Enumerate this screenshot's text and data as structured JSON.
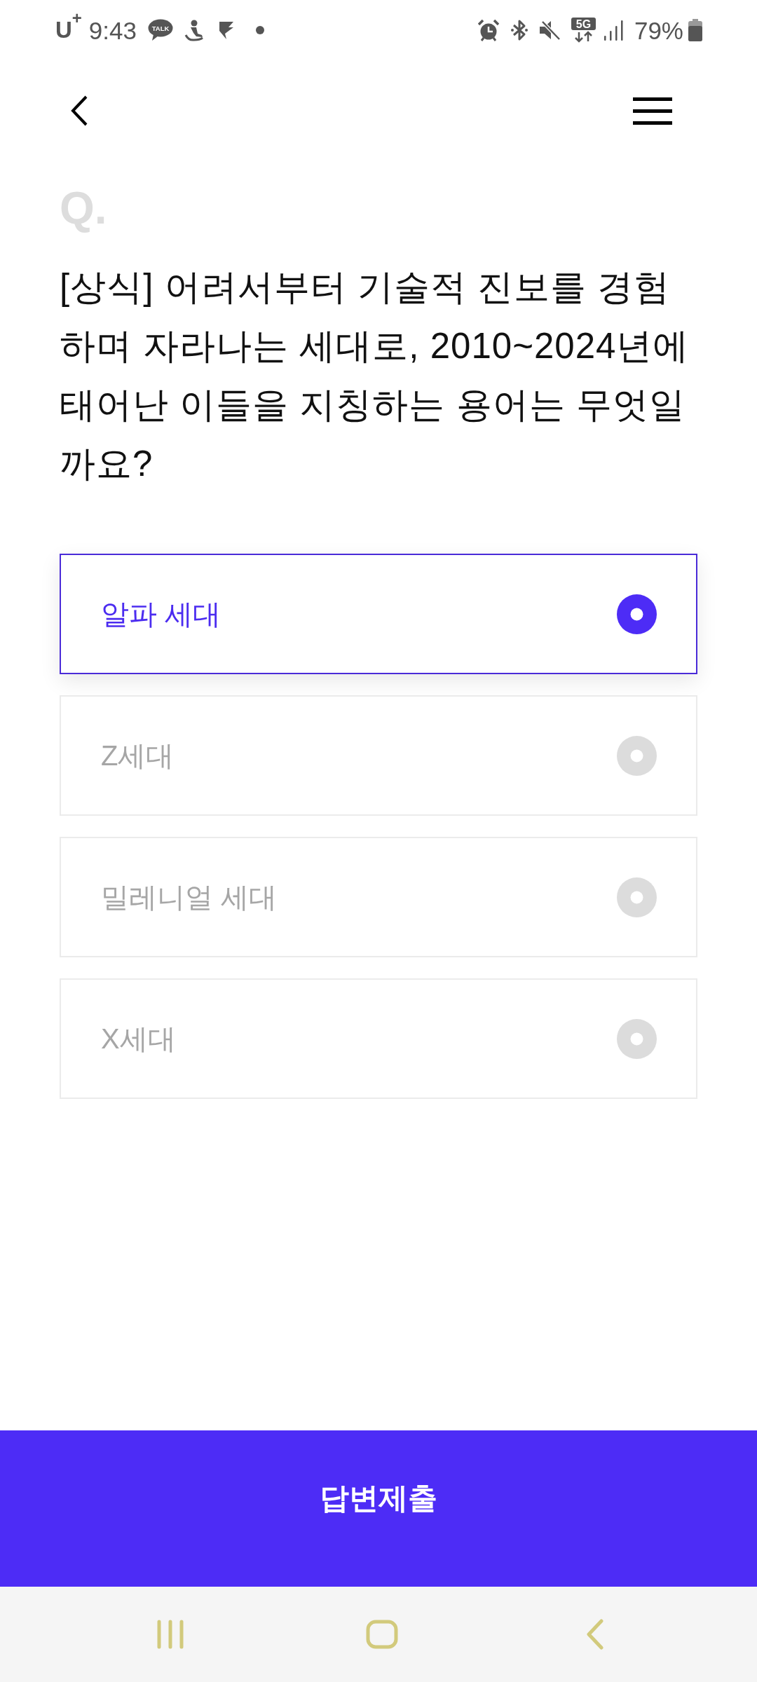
{
  "status_bar": {
    "carrier": "U$^{+}$",
    "time": "9:43",
    "chat_icon_label": "TALK",
    "network_label": "5G",
    "battery": "79%"
  },
  "question": {
    "marker": "Q.",
    "text": "[상식] 어려서부터 기술적 진보를 경험하며 자라나는 세대로, 2010~2024년에 태어난 이들을 지칭하는 용어는 무엇일까요?"
  },
  "options": [
    {
      "label": "알파 세대",
      "selected": true
    },
    {
      "label": "Z세대",
      "selected": false
    },
    {
      "label": "밀레니얼 세대",
      "selected": false
    },
    {
      "label": "X세대",
      "selected": false
    }
  ],
  "submit_button": {
    "label": "답변제출"
  }
}
